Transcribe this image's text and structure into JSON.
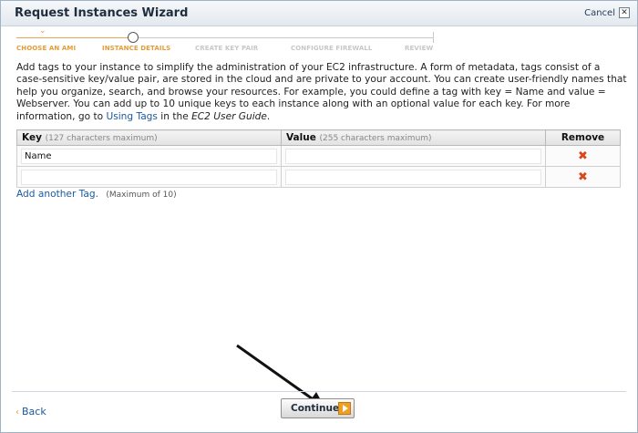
{
  "window": {
    "title": "Request Instances Wizard",
    "cancel_label": "Cancel",
    "close_glyph": "✕"
  },
  "steps": [
    {
      "label": "CHOOSE AN AMI",
      "state": "done"
    },
    {
      "label": "INSTANCE DETAILS",
      "state": "current"
    },
    {
      "label": "CREATE KEY PAIR",
      "state": "upcoming"
    },
    {
      "label": "CONFIGURE FIREWALL",
      "state": "upcoming"
    },
    {
      "label": "REVIEW",
      "state": "upcoming"
    }
  ],
  "description": {
    "text": "Add tags to your instance to simplify the administration of your EC2 infrastructure. A form of metadata, tags consist of a case-sensitive key/value pair, are stored in the cloud and are private to your account. You can create user-friendly names that help you organize, search, and browse your resources. For example, you could define a tag with key = Name and value = Webserver. You can add up to 10 unique keys to each instance along with an optional value for each key. For more information, go to ",
    "link_text": "Using Tags",
    "middle": " in the ",
    "guide": "EC2 User Guide",
    "end": "."
  },
  "table": {
    "key_header": "Key",
    "key_hint": "(127 characters maximum)",
    "value_header": "Value",
    "value_hint": "(255 characters maximum)",
    "remove_header": "Remove",
    "rows": [
      {
        "key": "Name",
        "value": ""
      },
      {
        "key": "",
        "value": ""
      }
    ],
    "remove_glyph": "✖"
  },
  "add_tag": {
    "link": "Add another Tag.",
    "hint": "(Maximum of 10)"
  },
  "footer": {
    "back_glyph": "‹",
    "back_label": "Back",
    "continue_label": "Continue"
  },
  "icons": {
    "remove": "remove-x-icon",
    "continue": "continue-arrow-icon",
    "annotation": "annotation-arrow-icon"
  },
  "colors": {
    "accent_orange": "#e59c38",
    "link_blue": "#1a5aa0",
    "remove_red": "#d9471b"
  }
}
